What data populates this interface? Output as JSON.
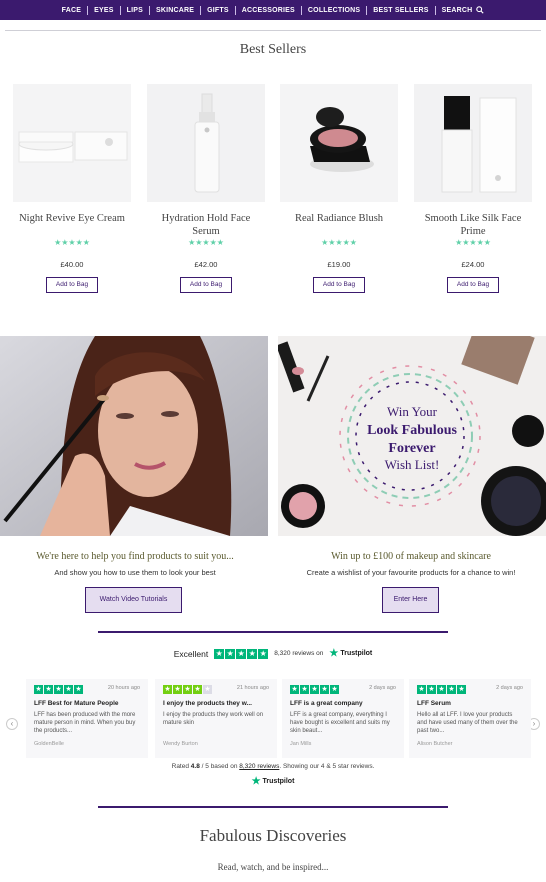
{
  "nav": {
    "items": [
      "FACE",
      "EYES",
      "LIPS",
      "SKINCARE",
      "GIFTS",
      "ACCESSORIES",
      "COLLECTIONS",
      "BEST SELLERS"
    ],
    "search_label": "SEARCH"
  },
  "best_sellers": {
    "title": "Best Sellers",
    "products": [
      {
        "name": "Night Revive Eye Cream",
        "price": "£40.00",
        "stars": "★★★★★",
        "button": "Add to Bag"
      },
      {
        "name": "Hydration Hold Face Serum",
        "price": "£42.00",
        "stars": "★★★★★",
        "button": "Add to Bag"
      },
      {
        "name": "Real Radiance Blush",
        "price": "£19.00",
        "stars": "★★★★★",
        "button": "Add to Bag"
      },
      {
        "name": "Smooth Like Silk Face Prime",
        "price": "£24.00",
        "stars": "★★★★★",
        "button": "Add to Bag"
      }
    ]
  },
  "promos": [
    {
      "title": "We're here to help you find products to suit you...",
      "subtitle": "And show you how to use them to look your best",
      "button": "Watch Video Tutorials"
    },
    {
      "title": "Win up to £100 of makeup and skincare",
      "subtitle": "Create a wishlist of your favourite products for a chance to win!",
      "button": "Enter Here",
      "image_text": [
        "Win Your",
        "Look Fabulous",
        "Forever",
        "Wish List!"
      ]
    }
  ],
  "trustpilot": {
    "rating_word": "Excellent",
    "review_count_text": "8,320 reviews on",
    "brand": "Trustpilot",
    "reviews": [
      {
        "time": "20 hours ago",
        "title": "LFF Best for Mature People",
        "body": "LFF has been produced with the more mature person in mind. When you buy the products...",
        "author": "GoldenBelle",
        "stars": 5
      },
      {
        "time": "21 hours ago",
        "title": "I enjoy the products they w...",
        "body": "I enjoy the products they work well on mature skin",
        "author": "Wendy Burton",
        "stars": 4
      },
      {
        "time": "2 days ago",
        "title": "LFF is a great company",
        "body": "LFF is a great company, everything I have bought is excellent and suits my skin beaut...",
        "author": "Jan Mills",
        "stars": 5
      },
      {
        "time": "2 days ago",
        "title": "LFF Serum",
        "body": "Hello all at LFF. I love your products and have used many of them over the past two...",
        "author": "Alison Butcher",
        "stars": 5
      }
    ],
    "rated_prefix": "Rated",
    "rated_score": "4.8",
    "rated_mid": "/ 5 based on",
    "rated_count": "8,320 reviews",
    "rated_suffix": ". Showing our 4 & 5 star reviews."
  },
  "discoveries": {
    "title": "Fabulous Discoveries",
    "subtitle": "Read, watch, and be inspired..."
  },
  "colors": {
    "brand": "#3b1a6e",
    "stars": "#5fd0a8",
    "trustpilot": "#00b67a"
  }
}
